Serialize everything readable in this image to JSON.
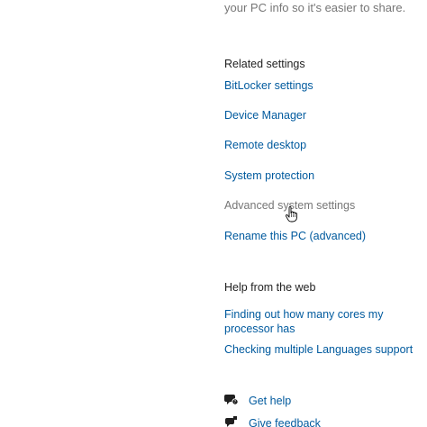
{
  "intro": {
    "text": "your PC info so it's easier to share."
  },
  "related_settings": {
    "title": "Related settings",
    "links": [
      "BitLocker settings",
      "Device Manager",
      "Remote desktop",
      "System protection",
      "Advanced system settings",
      "Rename this PC (advanced)"
    ]
  },
  "help_web": {
    "title": "Help from the web",
    "links": [
      "Finding out how many cores my processor has",
      "Checking multiple Languages support"
    ]
  },
  "support": {
    "get_help": "Get help",
    "give_feedback": "Give feedback"
  },
  "icons": {
    "get_help": "chat-help-icon",
    "give_feedback": "feedback-icon",
    "cursor": "hand-pointer-cursor"
  },
  "colors": {
    "link": "#005a9e",
    "link_hover": "#767676",
    "heading": "#1f1f1f",
    "muted": "#767676",
    "background": "#ffffff"
  }
}
